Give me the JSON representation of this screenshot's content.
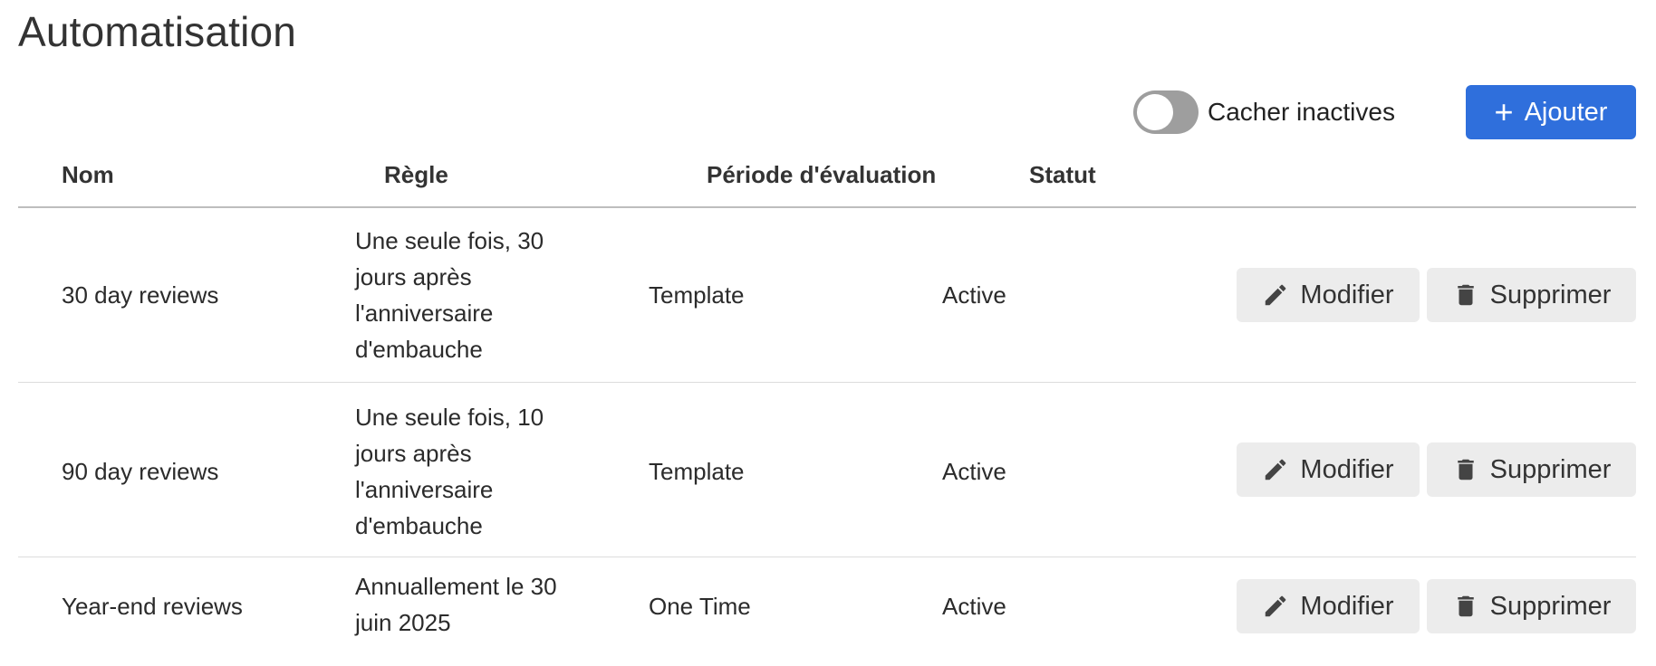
{
  "page": {
    "title": "Automatisation"
  },
  "toolbar": {
    "toggle_label": "Cacher inactives",
    "toggle_on": false,
    "add_label": "Ajouter"
  },
  "table": {
    "headers": [
      "Nom",
      "Règle",
      "Période d'évaluation",
      "Statut"
    ],
    "rows": [
      {
        "name": "30 day reviews",
        "rule": "Une seule fois, 30 jours après l'anniversaire d'embauche",
        "period": "Template",
        "status": "Active"
      },
      {
        "name": "90 day reviews",
        "rule": "Une seule fois, 10 jours après l'anniversaire d'embauche",
        "period": "Template",
        "status": "Active"
      },
      {
        "name": "Year-end reviews",
        "rule": "Annuallement le 30 juin 2025",
        "period": "One Time",
        "status": "Active"
      }
    ],
    "actions": {
      "edit_label": "Modifier",
      "delete_label": "Supprimer"
    }
  },
  "colors": {
    "primary": "#2f6fdc",
    "toggle_off": "#9e9e9e",
    "button_bg": "#ececec"
  },
  "icons": {
    "add": "plus-icon",
    "edit": "pencil-icon",
    "delete": "trash-icon"
  }
}
